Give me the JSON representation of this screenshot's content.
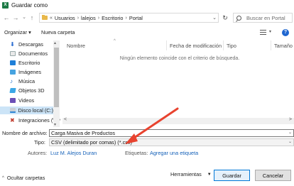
{
  "window": {
    "title": "Guardar como",
    "app_icon": "X"
  },
  "nav": {
    "back_glyph": "←",
    "forward_glyph": "→",
    "recent_glyph": "⌄",
    "up_glyph": "↑"
  },
  "path": {
    "overflow": "«",
    "crumbs": [
      "Usuarios",
      "lalejos",
      "Escritorio",
      "Portal"
    ],
    "separator": "›",
    "dropdown_glyph": "⌄",
    "refresh_glyph": "↻"
  },
  "search": {
    "placeholder": "Buscar en Portal"
  },
  "toolbar": {
    "organize": "Organizar ▾",
    "new_folder": "Nueva carpeta",
    "help": "?",
    "view_drop": "▾"
  },
  "sidebar": {
    "items": [
      {
        "label": "Descargas",
        "icon": "download-icon",
        "glyph": "⬇"
      },
      {
        "label": "Documentos",
        "icon": "documents-icon",
        "glyph": ""
      },
      {
        "label": "Escritorio",
        "icon": "desktop-icon",
        "glyph": ""
      },
      {
        "label": "Imágenes",
        "icon": "pictures-icon",
        "glyph": ""
      },
      {
        "label": "Música",
        "icon": "music-icon",
        "glyph": "♪"
      },
      {
        "label": "Objetos 3D",
        "icon": "objects3d-icon",
        "glyph": ""
      },
      {
        "label": "Videos",
        "icon": "videos-icon",
        "glyph": ""
      },
      {
        "label": "Disco local (C:)",
        "icon": "local-disk-icon",
        "glyph": "",
        "selected": true
      },
      {
        "label": "Integraciones (\\\\ ∨",
        "icon": "network-drive-icon",
        "glyph": "✖"
      }
    ]
  },
  "filelist": {
    "columns": [
      "Nombre",
      "Fecha de modificación",
      "Tipo",
      "Tamaño"
    ],
    "sort_glyph": "^",
    "empty_message": "Ningún elemento coincide con el criterio de búsqueda."
  },
  "scroll": {
    "left": "<",
    "right": ">",
    "up": "▴",
    "down": "▾"
  },
  "form": {
    "filename_label": "Nombre de archivo:",
    "filename_value": "Carga Masiva de Productos",
    "type_label": "Tipo:",
    "type_value": "CSV (delimitado por comas) (*.csv)",
    "authors_label": "Autores:",
    "authors_value": "Luz M. Alejos Duran",
    "tags_label": "Etiquetas:",
    "tags_value": "Agregar una etiqueta",
    "drop_glyph": "⌄"
  },
  "footer": {
    "hide_folders": "Ocultar carpetas",
    "hide_caret": "^",
    "tools": "Herramientas",
    "tools_caret": "▼",
    "save": "Guardar",
    "cancel": "Cancelar"
  },
  "colors": {
    "accent": "#0078d7",
    "arrow": "#e8432f",
    "link": "#1460b8",
    "selection": "#cce4f7"
  }
}
